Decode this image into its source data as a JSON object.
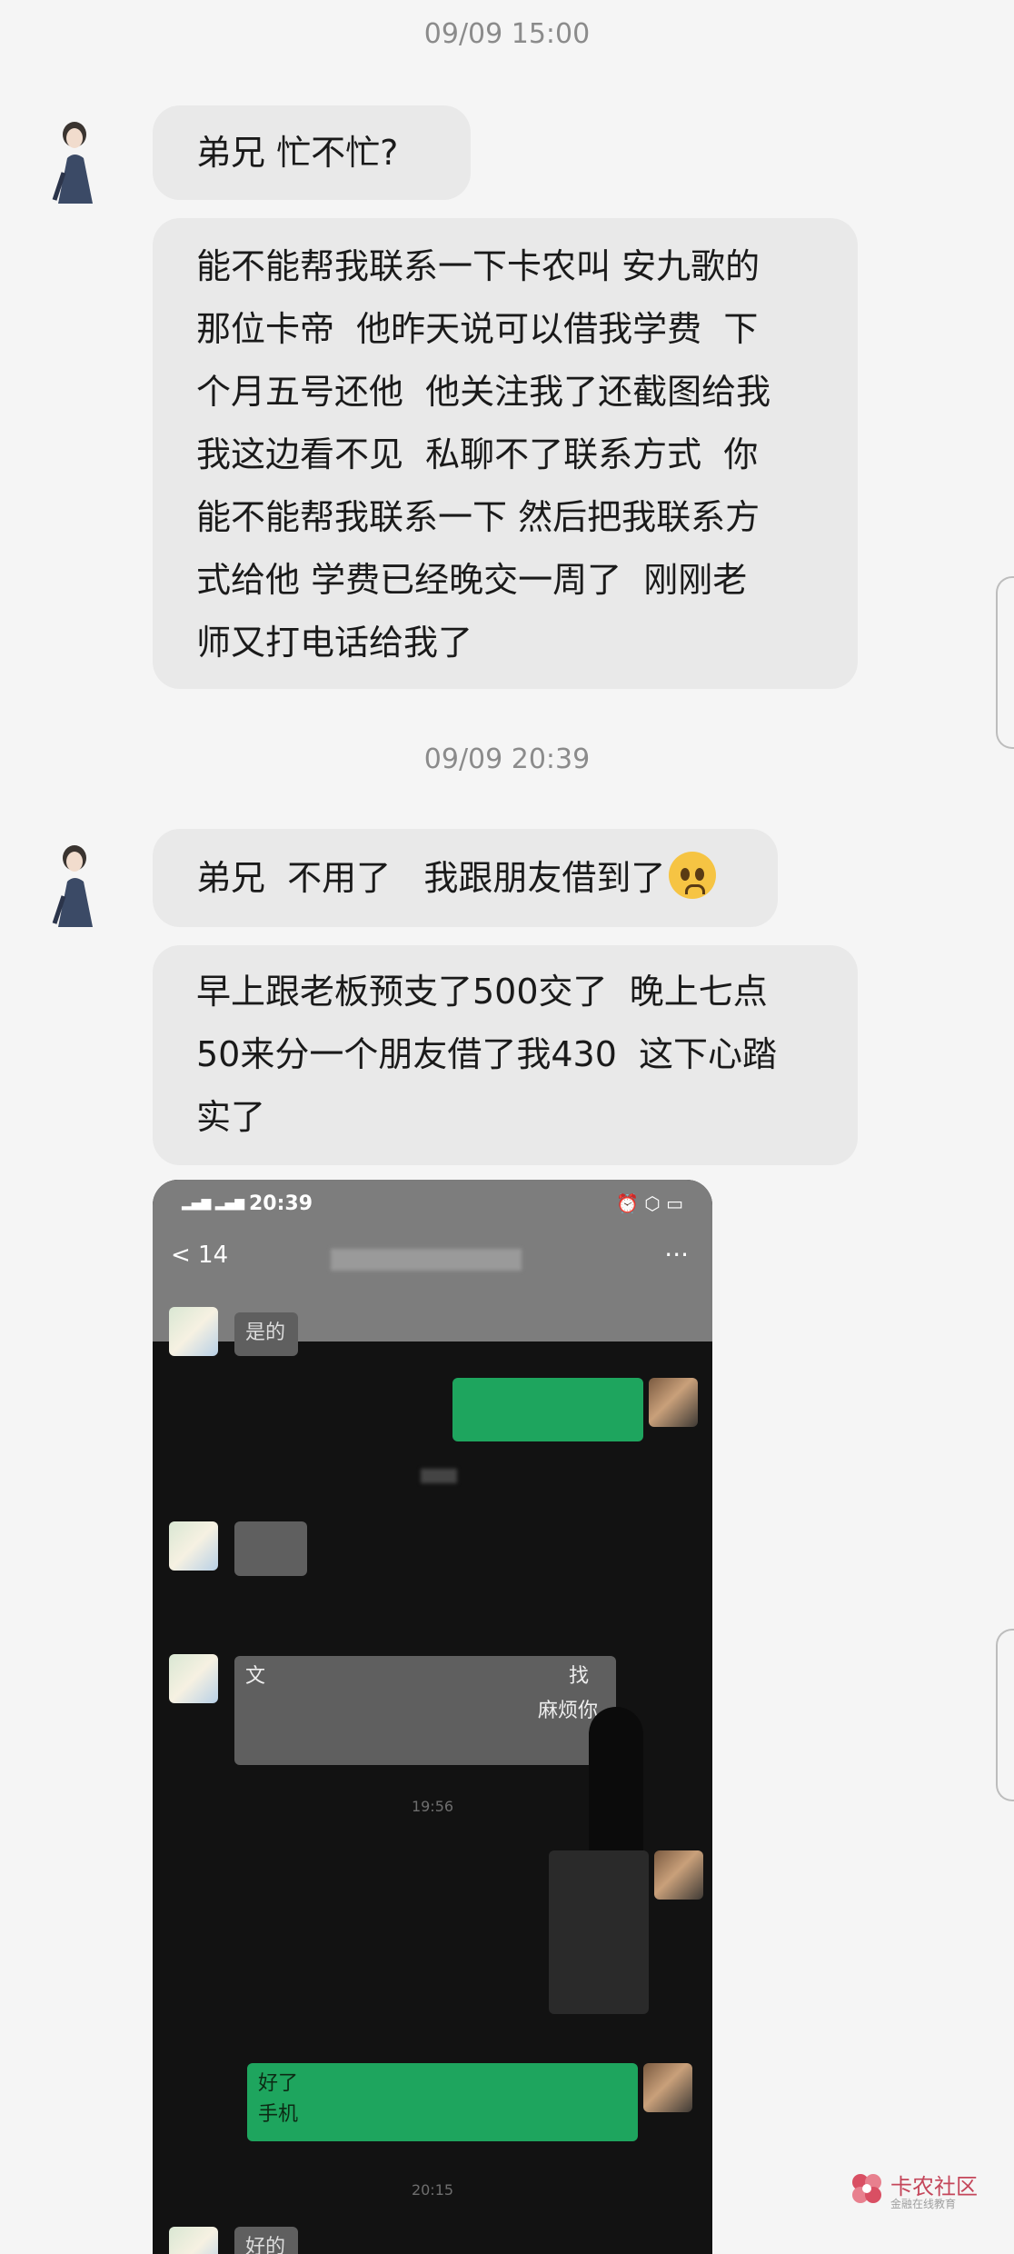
{
  "timestamps": [
    "09/09 15:00",
    "09/09 20:39"
  ],
  "messages": [
    "弟兄 忙不忙?",
    "能不能帮我联系一下卡农叫 安九歌的\n那位卡帝  他昨天说可以借我学费  下\n个月五号还他  他关注我了还截图给我\n我这边看不见  私聊不了联系方式  你\n能不能帮我联系一下 然后把我联系方\n式给他 学费已经晚交一周了  刚刚老\n师又打电话给我了",
    "弟兄  不用了   我跟朋友借到了",
    "早上跟老板预支了500交了  晚上七点\n50来分一个朋友借了我430  这下心踏\n实了"
  ],
  "emoji": "pleading-face-icon",
  "screenshot": {
    "status_time": "20:39",
    "back_label": "< 14",
    "more_icon": "···",
    "first_reply": "是的",
    "partial_text_1": "文",
    "partial_text_2": "找",
    "partial_text_3": "麻烦你",
    "time_1": "19:56",
    "green_text": "好了",
    "green_text_2": "手机",
    "time_2": "20:15",
    "last_partial": "好的"
  },
  "watermark": {
    "name": "卡农社区",
    "sub": "金融在线教育",
    "color": "#c4465a"
  }
}
